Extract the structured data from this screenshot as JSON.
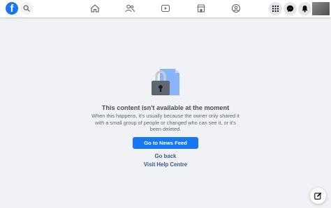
{
  "header": {
    "logo_letter": "f",
    "nav": [
      {
        "name": "home-icon"
      },
      {
        "name": "friends-icon"
      },
      {
        "name": "watch-icon"
      },
      {
        "name": "marketplace-icon"
      },
      {
        "name": "groups-icon"
      }
    ],
    "actions": [
      {
        "name": "menu-grid-icon"
      },
      {
        "name": "messenger-icon"
      },
      {
        "name": "notifications-bell-icon"
      }
    ]
  },
  "error": {
    "title": "This content isn't available at the moment",
    "description": "When this happens, it's usually because the owner only shared it with a small group of people or changed who can see it, or it's been deleted.",
    "primary_button": "Go to News Feed",
    "go_back": "Go back",
    "help": "Visit Help Centre"
  },
  "colors": {
    "brand": "#1877f2",
    "link": "#385898",
    "background": "#f0f2f5"
  }
}
